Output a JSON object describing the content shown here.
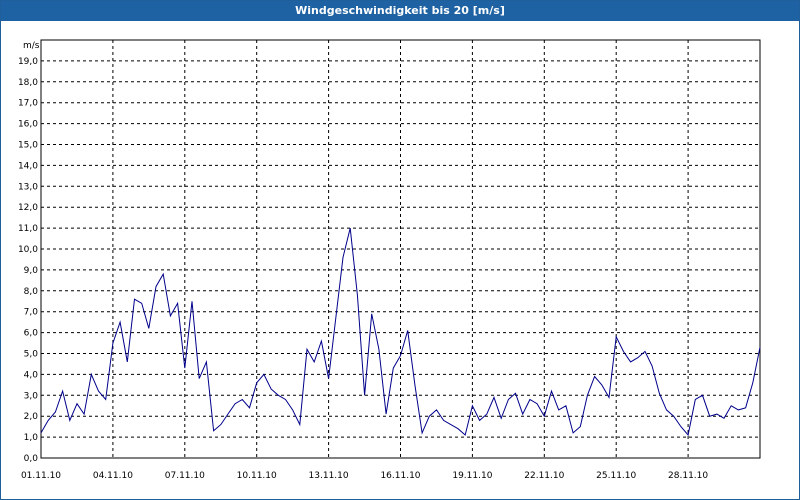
{
  "colors": {
    "title_bg": "#1f62a3",
    "title_text": "#ffffff",
    "line": "#00008b",
    "grid": "#000000"
  },
  "chart_data": {
    "type": "line",
    "title": "Windgeschwindigkeit bis 20 [m/s]",
    "ylabel": "m/s",
    "xlabel": "",
    "ylim": [
      0,
      20
    ],
    "y_ticks": [
      "0,0",
      "1,0",
      "2,0",
      "3,0",
      "4,0",
      "5,0",
      "6,0",
      "7,0",
      "8,0",
      "9,0",
      "10,0",
      "11,0",
      "12,0",
      "13,0",
      "14,0",
      "15,0",
      "16,0",
      "17,0",
      "18,0",
      "19,0"
    ],
    "x_ticks": [
      "01.11.10",
      "04.11.10",
      "07.11.10",
      "10.11.10",
      "13.11.10",
      "16.11.10",
      "19.11.10",
      "22.11.10",
      "25.11.10",
      "28.11.10"
    ],
    "x_range_days": [
      0,
      30
    ],
    "grid": true,
    "series": [
      {
        "x": [
          0,
          0.3,
          0.6,
          0.9,
          1.2,
          1.5,
          1.8,
          2.1,
          2.4,
          2.7,
          3.0,
          3.3,
          3.6,
          3.9,
          4.2,
          4.5,
          4.8,
          5.1,
          5.4,
          5.7,
          6.0,
          6.3,
          6.6,
          6.9,
          7.2,
          7.5,
          7.8,
          8.1,
          8.4,
          8.7,
          9.0,
          9.3,
          9.6,
          9.9,
          10.2,
          10.5,
          10.8,
          11.1,
          11.4,
          11.7,
          12.0,
          12.3,
          12.6,
          12.9,
          13.2,
          13.5,
          13.8,
          14.1,
          14.4,
          14.7,
          15.0,
          15.3,
          15.6,
          15.9,
          16.2,
          16.5,
          16.8,
          17.1,
          17.4,
          17.7,
          18.0,
          18.3,
          18.6,
          18.9,
          19.2,
          19.5,
          19.8,
          20.1,
          20.4,
          20.7,
          21.0,
          21.3,
          21.6,
          21.9,
          22.2,
          22.5,
          22.8,
          23.1,
          23.4,
          23.7,
          24.0,
          24.3,
          24.6,
          24.9,
          25.2,
          25.5,
          25.8,
          26.1,
          26.4,
          26.7,
          27.0,
          27.3,
          27.6,
          27.9,
          28.2,
          28.5,
          28.8,
          29.1,
          29.4,
          29.7,
          30.0
        ],
        "values": [
          1.2,
          1.8,
          2.2,
          3.2,
          1.8,
          2.6,
          2.1,
          4.0,
          3.2,
          2.8,
          5.5,
          6.5,
          4.6,
          7.6,
          7.4,
          6.2,
          8.2,
          8.8,
          6.8,
          7.4,
          4.3,
          7.5,
          3.8,
          4.6,
          1.3,
          1.6,
          2.1,
          2.6,
          2.8,
          2.4,
          3.6,
          4.0,
          3.3,
          3.0,
          2.8,
          2.3,
          1.6,
          5.2,
          4.6,
          5.6,
          3.8,
          6.7,
          9.6,
          11.0,
          7.8,
          3.0,
          6.9,
          5.2,
          2.1,
          4.3,
          4.9,
          6.1,
          3.5,
          1.2,
          2.0,
          2.3,
          1.8,
          1.6,
          1.4,
          1.1,
          2.5,
          1.8,
          2.1,
          2.9,
          1.9,
          2.8,
          3.1,
          2.1,
          2.8,
          2.6,
          2.0,
          3.2,
          2.3,
          2.5,
          1.2,
          1.5,
          3.0,
          3.9,
          3.5,
          2.9,
          5.8,
          5.1,
          4.6,
          4.8,
          5.1,
          4.4,
          3.1,
          2.3,
          2.0,
          1.5,
          1.1,
          2.8,
          3.0,
          2.0,
          2.1,
          1.9,
          2.5,
          2.3,
          2.4,
          3.6,
          5.3
        ]
      }
    ]
  }
}
